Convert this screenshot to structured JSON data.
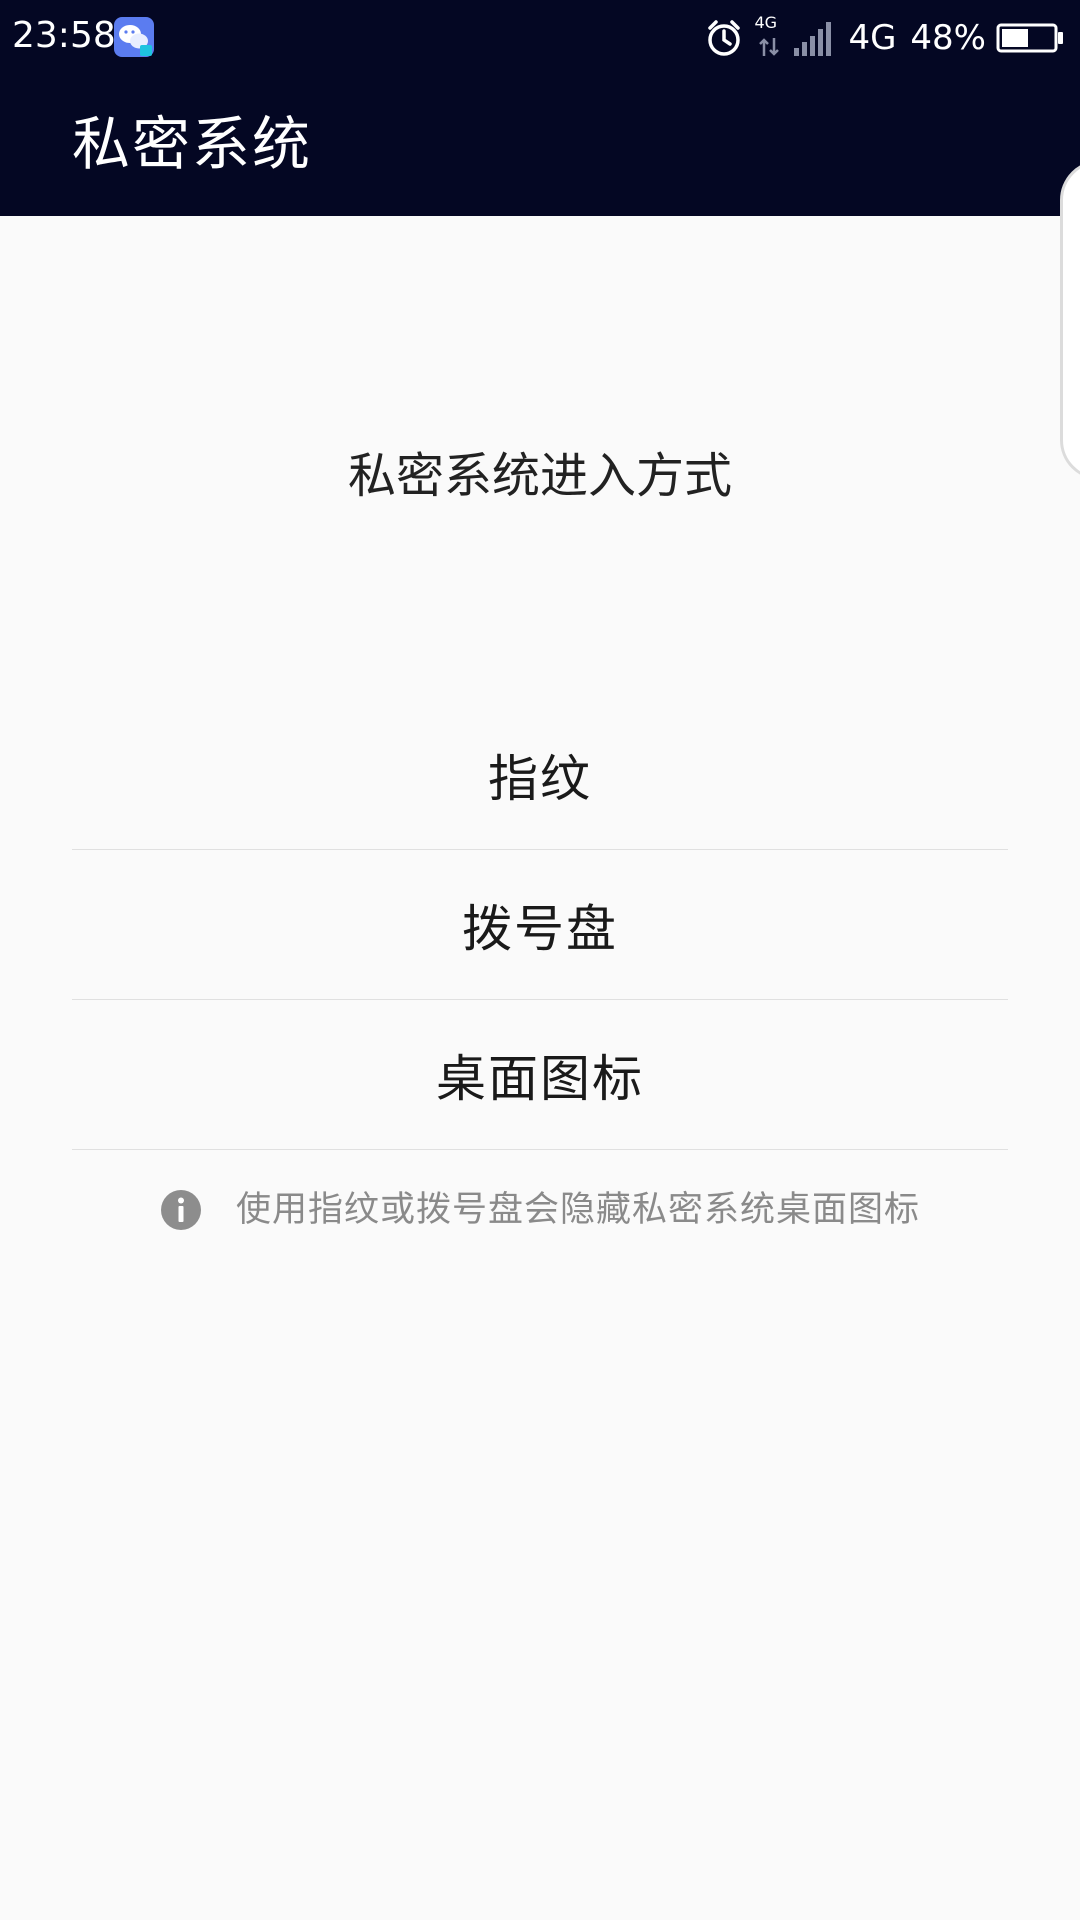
{
  "status_bar": {
    "time": "23:58",
    "network_small": "4G",
    "network": "4G",
    "battery": "48%"
  },
  "app_bar": {
    "title": "私密系统"
  },
  "main": {
    "section_title": "私密系统进入方式",
    "options": [
      {
        "label": "指纹"
      },
      {
        "label": "拨号盘"
      },
      {
        "label": "桌面图标"
      }
    ],
    "info_text": "使用指纹或拨号盘会隐藏私密系统桌面图标"
  },
  "colors": {
    "topbar_bg": "#040723",
    "page_bg": "#fafafa",
    "info_gray": "#8a8a8a"
  },
  "icons": {
    "notification": "wechat-icon",
    "alarm": "alarm-icon",
    "data": "data-arrows-icon",
    "signal": "signal-icon",
    "battery": "battery-icon",
    "info": "info-icon"
  }
}
